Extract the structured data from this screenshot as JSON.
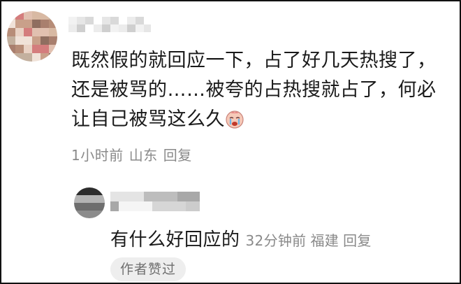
{
  "comment": {
    "text": "既然假的就回应一下，占了好几天热搜了，还是被骂的……被夸的占热搜就占了，何必让自己被骂这么久",
    "emoji_icon": "crying-face-icon",
    "time": "1小时前",
    "location": "山东",
    "reply_label": "回复"
  },
  "reply": {
    "text": "有什么好回应的",
    "time": "32分钟前",
    "location": "福建",
    "reply_label": "回复",
    "author_badge": "作者赞过"
  },
  "colors": {
    "text": "#1a1a1a",
    "meta": "#8a8a8a",
    "badge_bg": "#eeeeee",
    "border": "#111111"
  }
}
